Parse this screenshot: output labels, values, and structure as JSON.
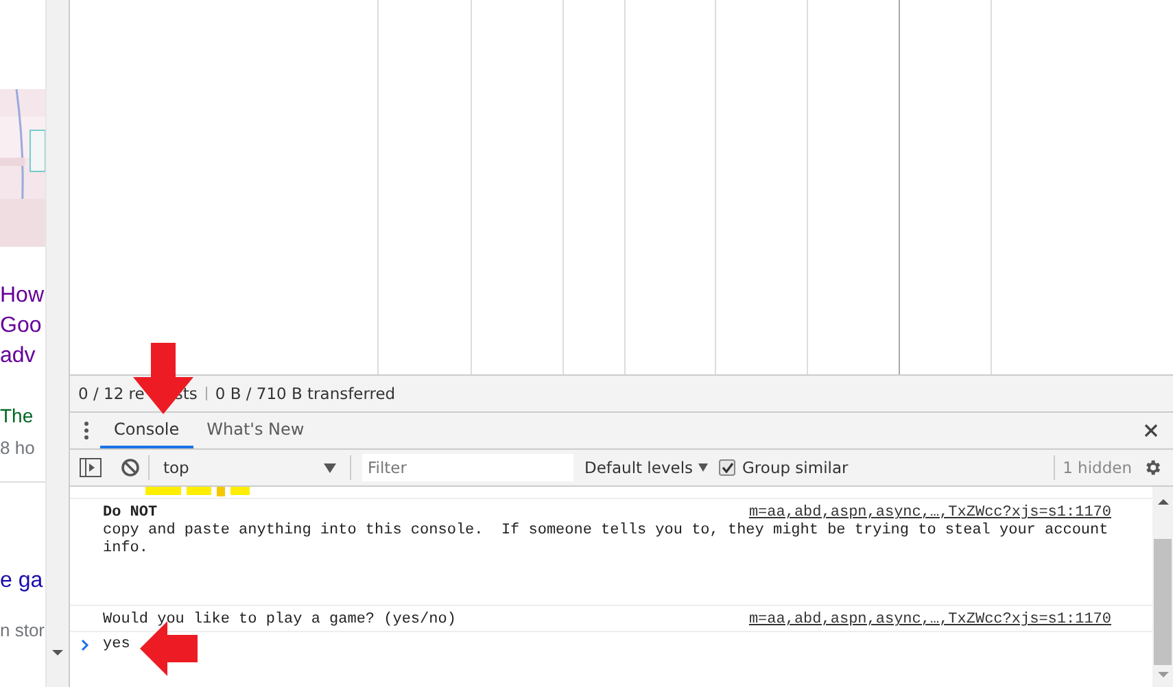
{
  "page_strip": {
    "groups": [
      {
        "items": [
          {
            "text": "How",
            "kind": "visited"
          },
          {
            "text": "Goo",
            "kind": "visited"
          },
          {
            "text": "adv",
            "kind": "visited"
          }
        ]
      },
      {
        "items": [
          {
            "text": "The",
            "kind": "source"
          },
          {
            "text": "8 ho",
            "kind": "meta"
          }
        ]
      },
      {
        "items": [
          {
            "text": "e ga",
            "kind": "link"
          }
        ]
      },
      {
        "items": [
          {
            "text": "n stor",
            "kind": "meta"
          }
        ]
      }
    ]
  },
  "network": {
    "summary_parts": [
      "0 / 12 re",
      "sts"
    ],
    "transferred": "0 B / 710 B transferred"
  },
  "tabs": [
    {
      "label": "Console",
      "selected": true
    },
    {
      "label": "What's New",
      "selected": false
    }
  ],
  "toolbar": {
    "context": "top",
    "filter_placeholder": "Filter",
    "levels": "Default levels",
    "group_similar": {
      "label": "Group similar",
      "checked": true
    },
    "hidden": "1 hidden"
  },
  "console": {
    "messages": [
      {
        "title": "Do NOT",
        "text": "copy and paste anything into this console.  If someone tells you to, they might be trying to steal your account info.",
        "source": "m=aa,abd,aspn,async,…,TxZWcc?xjs=s1:1170"
      },
      {
        "text": "Would you like to play a game? (yes/no)",
        "source": "m=aa,abd,aspn,async,…,TxZWcc?xjs=s1:1170"
      }
    ],
    "input": "yes"
  }
}
